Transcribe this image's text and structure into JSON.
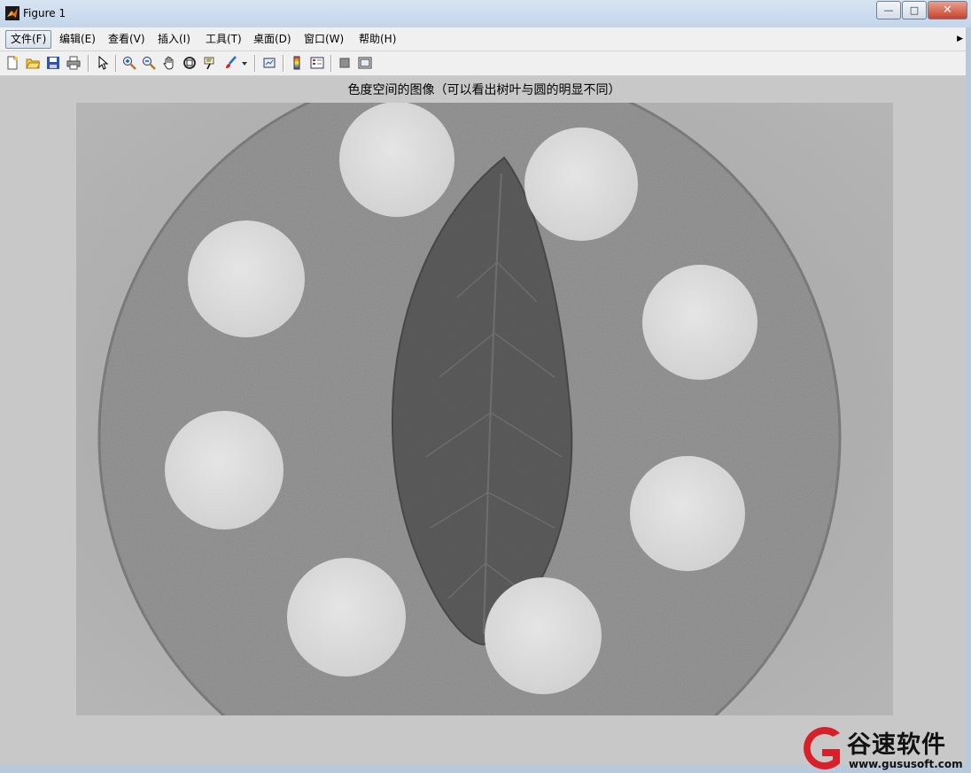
{
  "window": {
    "title": "Figure 1"
  },
  "title_buttons": {
    "minimize": "—",
    "maximize": "□",
    "close": "✕"
  },
  "menu": [
    {
      "label": "文件(F)"
    },
    {
      "label": "编辑(E)"
    },
    {
      "label": "查看(V)"
    },
    {
      "label": "插入(I)"
    },
    {
      "label": "工具(T)"
    },
    {
      "label": "桌面(D)"
    },
    {
      "label": "窗口(W)"
    },
    {
      "label": "帮助(H)"
    }
  ],
  "toolbar": {
    "icons": [
      "new-figure-icon",
      "open-file-icon",
      "save-icon",
      "print-icon",
      "pointer-icon",
      "zoom-in-icon",
      "zoom-out-icon",
      "pan-hand-icon",
      "rotate-3d-icon",
      "data-cursor-icon",
      "brush-icon",
      "dropdown-arrow-icon",
      "link-plot-icon",
      "colorbar-icon",
      "legend-icon",
      "hide-plot-tools-icon",
      "show-plot-tools-icon"
    ]
  },
  "plot": {
    "title": "色度空间的图像（可以看出树叶与圆的明显不同）"
  },
  "watermark": {
    "brand": "谷速软件",
    "url": "www.gususoft.com"
  },
  "colors": {
    "accent": "#2a6fc9",
    "close": "#c7432b",
    "watermark_red": "#d8202a"
  }
}
